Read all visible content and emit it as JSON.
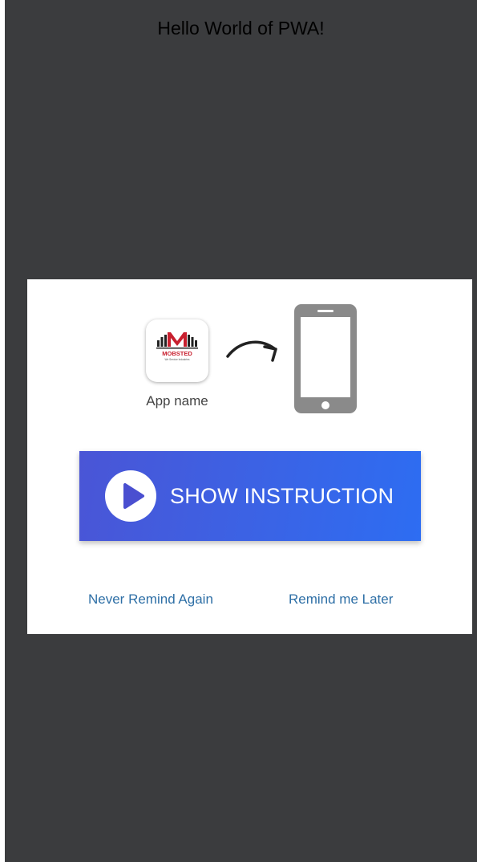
{
  "page": {
    "title": "Hello World of PWA!"
  },
  "modal": {
    "app_icon": "mobsted-logo",
    "app_logo_text": "MOBSTED",
    "app_logo_tagline": "We Service Industries",
    "app_name": "App name",
    "transfer_icon": "curved-arrow-right-icon",
    "device_icon": "smartphone-icon",
    "show_button": {
      "icon": "play-icon",
      "label": "SHOW INSTRUCTION"
    },
    "never_remind_label": "Never Remind Again",
    "remind_later_label": "Remind me Later"
  },
  "colors": {
    "backdrop": "#3b3c3e",
    "button_gradient_start": "#4a55d6",
    "button_gradient_end": "#2d6df2",
    "link": "#2e6fa6",
    "logo_red": "#c8202f",
    "phone_gray": "#8a8a8a"
  }
}
